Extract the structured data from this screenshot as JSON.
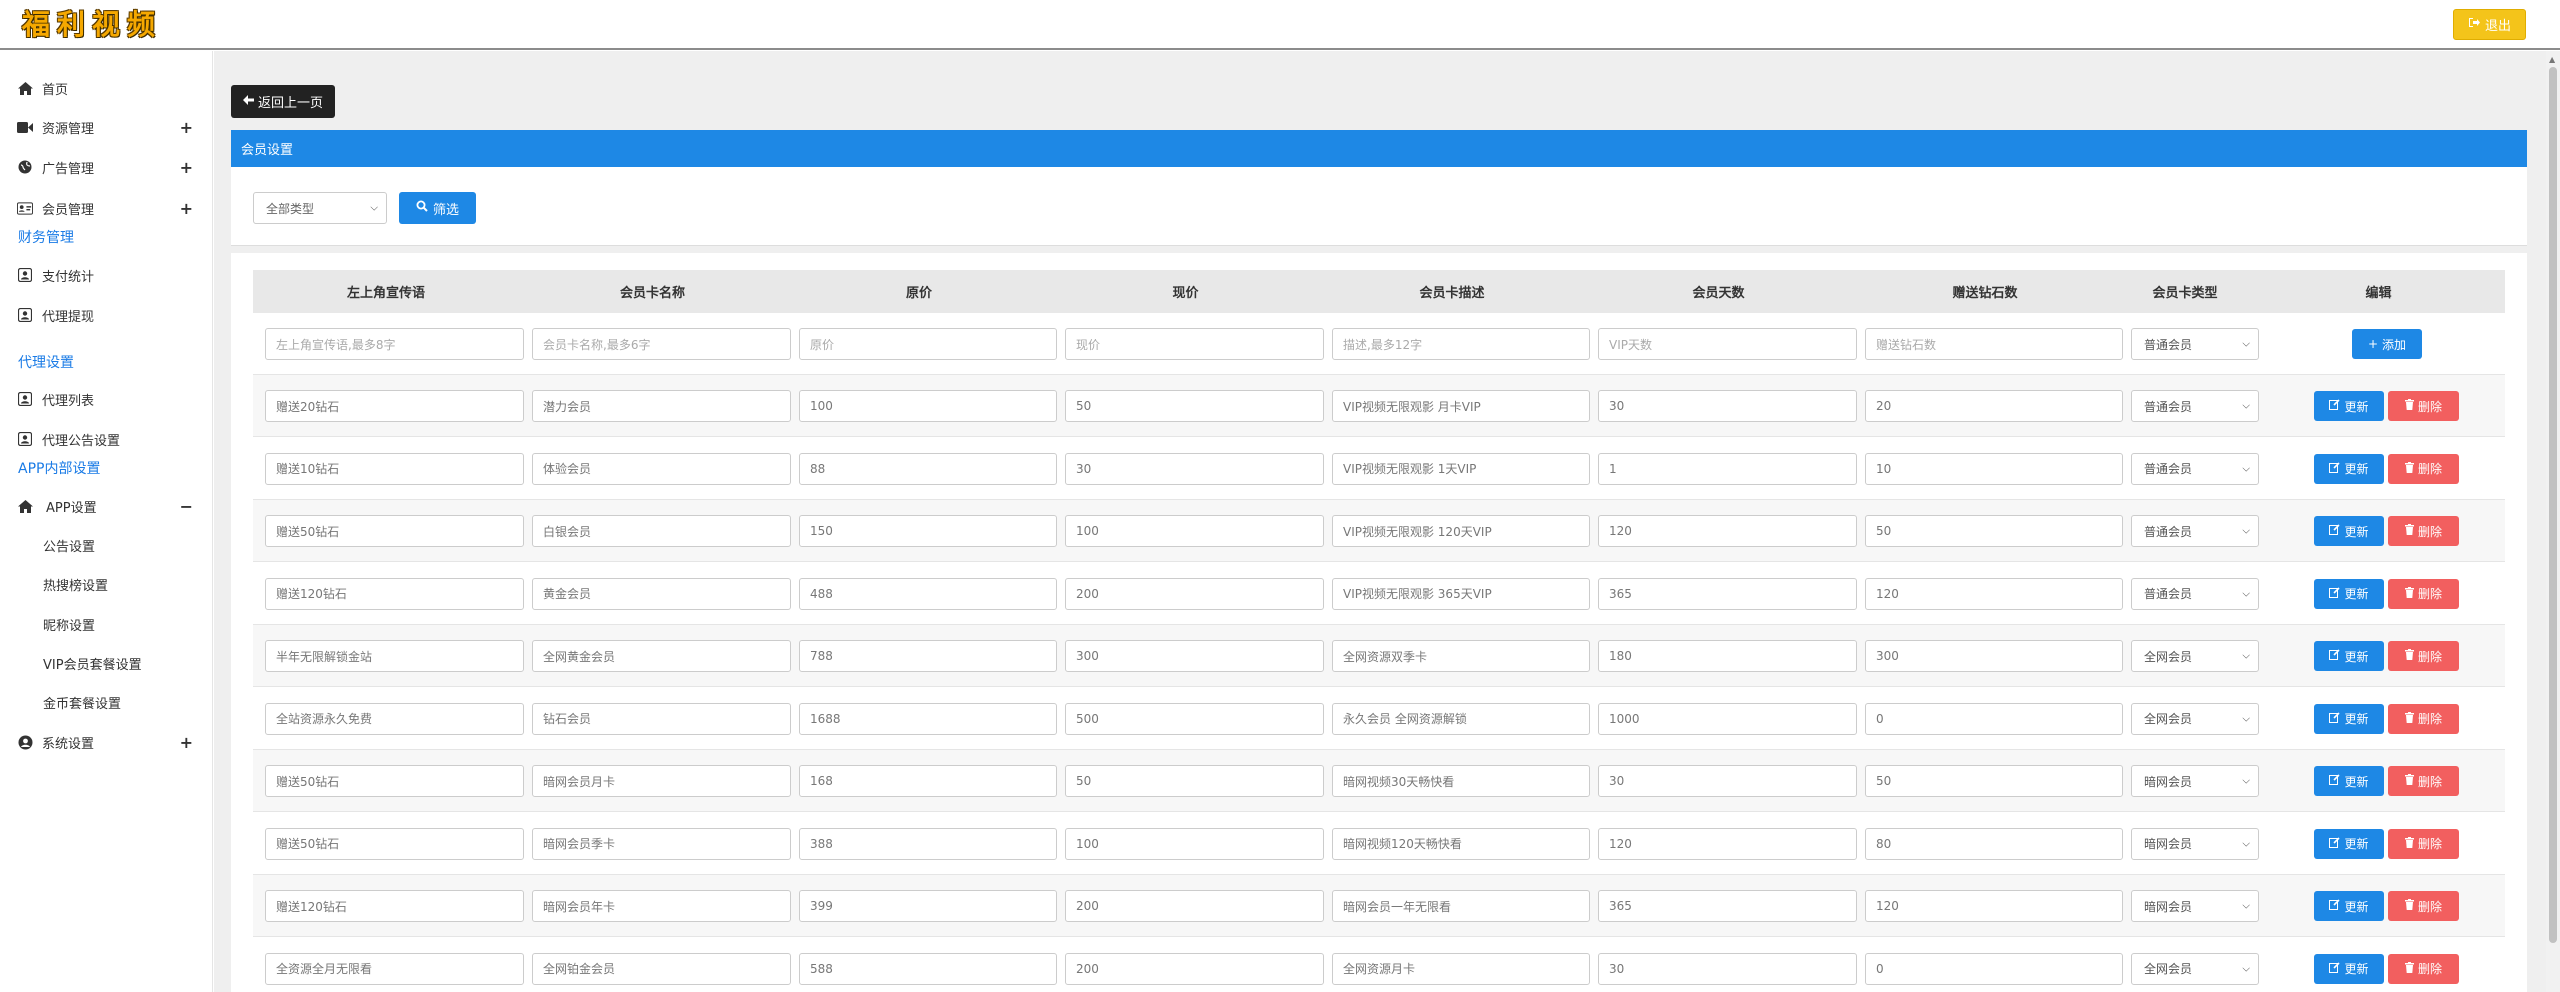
{
  "header": {
    "logo_chars": [
      "福",
      "利",
      "视",
      "频"
    ],
    "logout_label": "退出"
  },
  "sidebar": {
    "items": [
      {
        "label": "首页",
        "icon": "home-icon"
      },
      {
        "label": "资源管理",
        "icon": "video-camera-icon",
        "expand": "+"
      },
      {
        "label": "广告管理",
        "icon": "globe-icon",
        "expand": "+"
      },
      {
        "label": "会员管理",
        "icon": "id-card-icon",
        "expand": "+"
      }
    ],
    "section_finance": "财务管理",
    "finance_items": [
      {
        "label": "支付统计",
        "icon": "user-square-icon"
      },
      {
        "label": "代理提现",
        "icon": "user-square-icon"
      }
    ],
    "section_agent": "代理设置",
    "agent_items": [
      {
        "label": "代理列表",
        "icon": "user-square-icon"
      },
      {
        "label": "代理公告设置",
        "icon": "user-square-icon"
      }
    ],
    "section_app": "APP内部设置",
    "app_group": {
      "label": "APP设置",
      "icon": "home-icon",
      "expand": "−"
    },
    "app_sub": [
      "公告设置",
      "热搜榜设置",
      "昵称设置",
      "VIP会员套餐设置",
      "金币套餐设置"
    ],
    "system": {
      "label": "系统设置",
      "icon": "user-circle-icon",
      "expand": "+"
    }
  },
  "main": {
    "back_label": "返回上一页",
    "panel_title": "会员设置",
    "filter_select": "全部类型",
    "filter_button": "筛选",
    "columns": [
      "左上角宣传语",
      "会员卡名称",
      "原价",
      "现价",
      "会员卡描述",
      "会员天数",
      "赠送钻石数",
      "会员卡类型",
      "编辑"
    ],
    "new_row": {
      "placeholders": [
        "左上角宣传语,最多8字",
        "会员卡名称,最多6字",
        "原价",
        "现价",
        "描述,最多12字",
        "VIP天数",
        "赠送钻石数"
      ],
      "type": "普通会员",
      "add_label": "添加"
    },
    "update_label": "更新",
    "delete_label": "删除",
    "rows": [
      {
        "promo": "赠送20钻石",
        "name": "潜力会员",
        "orig": "100",
        "price": "50",
        "desc": "VIP视频无限观影 月卡VIP",
        "days": "30",
        "gems": "20",
        "type": "普通会员"
      },
      {
        "promo": "赠送10钻石",
        "name": "体验会员",
        "orig": "88",
        "price": "30",
        "desc": "VIP视频无限观影 1天VIP",
        "days": "1",
        "gems": "10",
        "type": "普通会员"
      },
      {
        "promo": "赠送50钻石",
        "name": "白银会员",
        "orig": "150",
        "price": "100",
        "desc": "VIP视频无限观影 120天VIP",
        "days": "120",
        "gems": "50",
        "type": "普通会员"
      },
      {
        "promo": "赠送120钻石",
        "name": "黄金会员",
        "orig": "488",
        "price": "200",
        "desc": "VIP视频无限观影 365天VIP",
        "days": "365",
        "gems": "120",
        "type": "普通会员"
      },
      {
        "promo": "半年无限解锁金站",
        "name": "全网黄金会员",
        "orig": "788",
        "price": "300",
        "desc": "全网资源双季卡",
        "days": "180",
        "gems": "300",
        "type": "全网会员"
      },
      {
        "promo": "全站资源永久免费",
        "name": "钻石会员",
        "orig": "1688",
        "price": "500",
        "desc": "永久会员 全网资源解锁",
        "days": "1000",
        "gems": "0",
        "type": "全网会员"
      },
      {
        "promo": "赠送50钻石",
        "name": "暗网会员月卡",
        "orig": "168",
        "price": "50",
        "desc": "暗网视频30天畅快看",
        "days": "30",
        "gems": "50",
        "type": "暗网会员"
      },
      {
        "promo": "赠送50钻石",
        "name": "暗网会员季卡",
        "orig": "388",
        "price": "100",
        "desc": "暗网视频120天畅快看",
        "days": "120",
        "gems": "80",
        "type": "暗网会员"
      },
      {
        "promo": "赠送120钻石",
        "name": "暗网会员年卡",
        "orig": "399",
        "price": "200",
        "desc": "暗网会员一年无限看",
        "days": "365",
        "gems": "120",
        "type": "暗网会员"
      },
      {
        "promo": "全资源全月无限看",
        "name": "全网铂金会员",
        "orig": "588",
        "price": "200",
        "desc": "全网资源月卡",
        "days": "30",
        "gems": "0",
        "type": "全网会员"
      }
    ]
  }
}
